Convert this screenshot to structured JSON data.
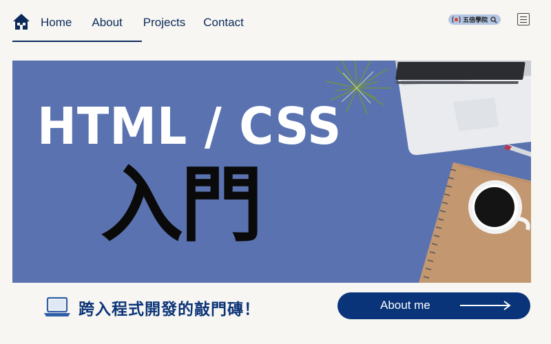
{
  "nav": {
    "home_icon": "house-icon",
    "links": [
      {
        "label": "Home"
      },
      {
        "label": "About"
      },
      {
        "label": "Projects"
      },
      {
        "label": "Contact"
      }
    ],
    "brand": {
      "name": "五倍學院",
      "logo_icon": "brand-logo-icon",
      "search_icon": "search-icon"
    },
    "menu_icon": "hamburger-menu-icon"
  },
  "hero": {
    "title": "HTML / CSS",
    "subtitle": "入門"
  },
  "tagline": {
    "icon": "laptop-icon",
    "text": "跨入程式開發的敲門磚！"
  },
  "cta": {
    "label": "About me",
    "icon": "arrow-right-icon"
  },
  "colors": {
    "page_background": "#f7f6f2",
    "navy": "#0b2a5b",
    "hero_blue": "#5a73b0",
    "button_blue": "#0a347a",
    "tagline_blue": "#0b3478",
    "brand_pill": "#b5c6e3"
  }
}
